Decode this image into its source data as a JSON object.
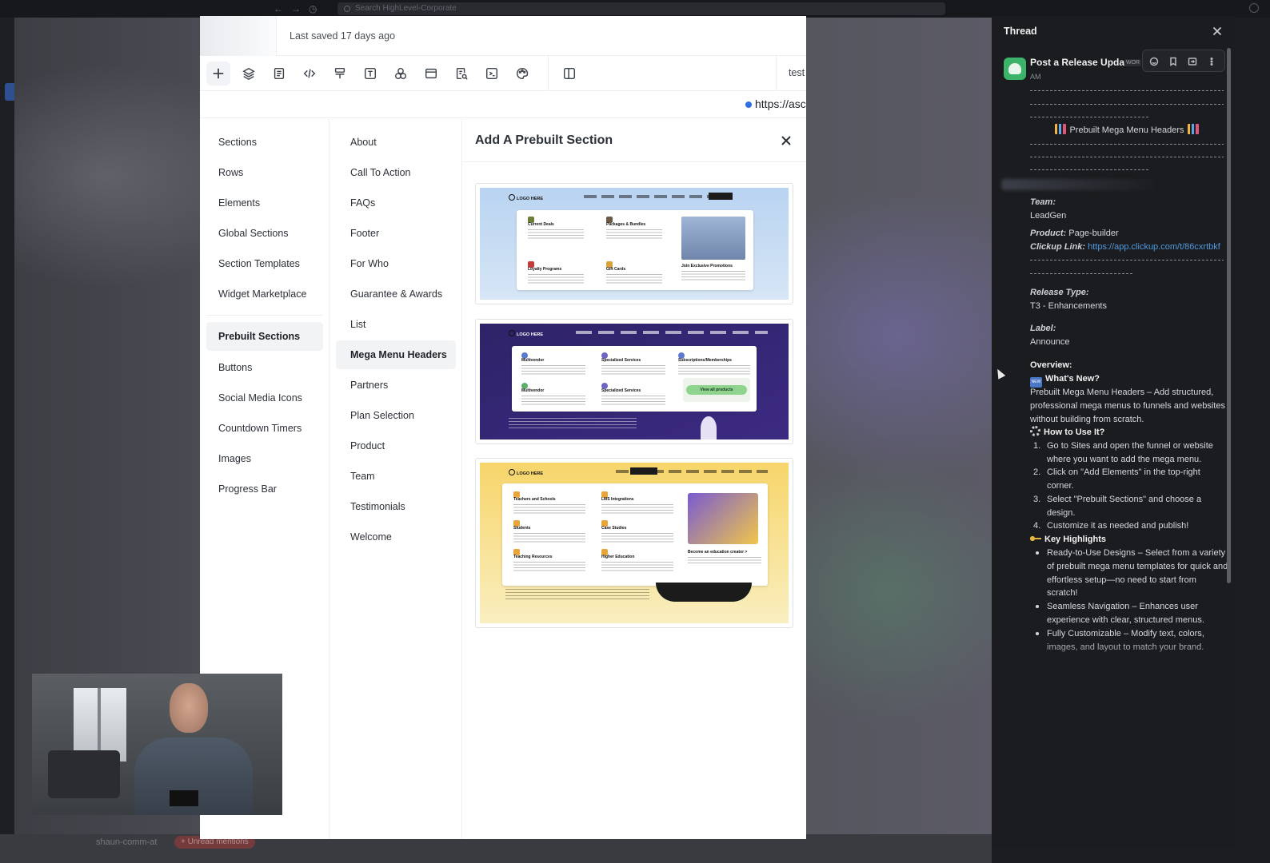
{
  "topbar": {
    "search_placeholder": "Search HighLevel-Corporate"
  },
  "bottom": {
    "channel": "shaun-comm-at",
    "mentions": "+ Unread mentions"
  },
  "builder": {
    "last_saved": "Last saved 17 days ago",
    "test_label": "test",
    "url": "https://asc",
    "toolbar": [
      "add-icon",
      "layers-icon",
      "page-icon",
      "code-icon",
      "paint-roller-icon",
      "text-icon",
      "shapes-icon",
      "layout-icon",
      "search-page-icon",
      "terminal-icon",
      "palette-icon",
      "split-view-icon"
    ],
    "categories": [
      {
        "label": "Sections",
        "active": false
      },
      {
        "label": "Rows",
        "active": false
      },
      {
        "label": "Elements",
        "active": false
      },
      {
        "label": "Global Sections",
        "active": false
      },
      {
        "label": "Section Templates",
        "active": false
      },
      {
        "label": "Widget Marketplace",
        "active": false
      },
      {
        "label": "Prebuilt Sections",
        "active": true
      },
      {
        "label": "Buttons",
        "active": false
      },
      {
        "label": "Social Media Icons",
        "active": false
      },
      {
        "label": "Countdown Timers",
        "active": false
      },
      {
        "label": "Images",
        "active": false
      },
      {
        "label": "Progress Bar",
        "active": false
      }
    ],
    "subcategories": [
      {
        "label": "About",
        "active": false
      },
      {
        "label": "Call To Action",
        "active": false
      },
      {
        "label": "FAQs",
        "active": false
      },
      {
        "label": "Footer",
        "active": false
      },
      {
        "label": "For Who",
        "active": false
      },
      {
        "label": "Guarantee & Awards",
        "active": false
      },
      {
        "label": "List",
        "active": false
      },
      {
        "label": "Mega Menu Headers",
        "active": true
      },
      {
        "label": "Partners",
        "active": false
      },
      {
        "label": "Plan Selection",
        "active": false
      },
      {
        "label": "Product",
        "active": false
      },
      {
        "label": "Team",
        "active": false
      },
      {
        "label": "Testimonials",
        "active": false
      },
      {
        "label": "Welcome",
        "active": false
      }
    ],
    "prebuilt_title": "Add A Prebuilt Section",
    "thumbnails": [
      {
        "theme": "light-blue",
        "logo": "LOGO HERE",
        "bg": "#c8dcf3",
        "accent": "#1c1c1c"
      },
      {
        "theme": "purple",
        "logo": "LOGO HERE",
        "bg": "#3a2a7a",
        "accent": "#7fd17f",
        "cta": "View all products"
      },
      {
        "theme": "yellow",
        "logo": "LOGO HERE",
        "bg": "#f6e6a8",
        "accent": "#e2a13a",
        "promo": "Become an education creator >"
      }
    ]
  },
  "thread": {
    "title": "Thread",
    "author": "Post a Release Update",
    "tag": "WOR",
    "time": "AM",
    "headline": "Prebuilt Mega Menu Headers",
    "team_label": "Team:",
    "team_value": "LeadGen",
    "product_label": "Product:",
    "product_value": "Page-builder",
    "clickup_label": "Clickup Link:",
    "clickup_value": "https://app.clickup.com/t/86cxrtbkf",
    "release_type_label": "Release Type:",
    "release_type_value": "T3 - Enhancements",
    "label_label": "Label:",
    "label_value": "Announce",
    "overview_label": "Overview:",
    "whats_new": "What's New?",
    "whats_new_body": "Prebuilt Mega Menu Headers – Add structured, professional mega menus to funnels and websites without building from scratch.",
    "how_to": "How to Use It?",
    "steps": [
      "Go to Sites and open the funnel or website where you want to add the mega menu.",
      "Click on \"Add Elements\" in the top-right corner.",
      "Select \"Prebuilt Sections\" and choose a design.",
      "Customize it as needed and publish!"
    ],
    "key_highlights": "Key Highlights",
    "highlights": [
      "Ready-to-Use Designs – Select from a variety of prebuilt mega menu templates for quick and effortless setup—no need to start from scratch!",
      "Seamless Navigation – Enhances user experience with clear, structured menus.",
      "Fully Customizable – Modify text, colors, images, and layout to match your brand."
    ]
  }
}
